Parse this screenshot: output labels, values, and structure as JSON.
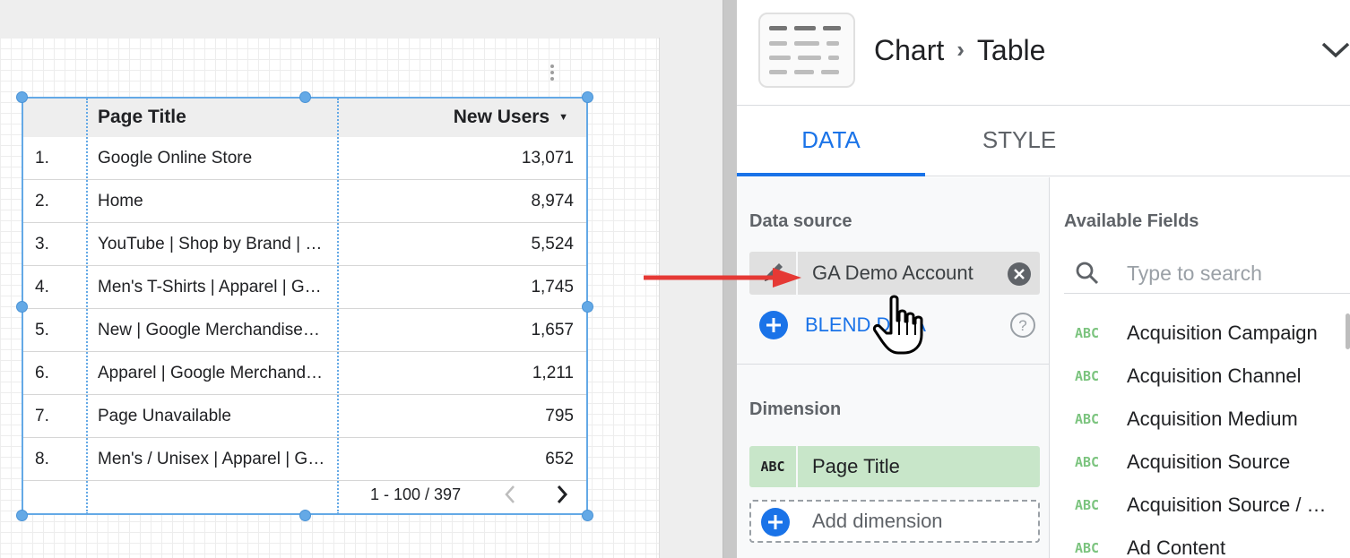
{
  "table": {
    "headers": {
      "page_title": "Page Title",
      "new_users": "New Users"
    },
    "rows": [
      {
        "index": "1.",
        "title": "Google Online Store",
        "value": "13,071"
      },
      {
        "index": "2.",
        "title": "Home",
        "value": "8,974"
      },
      {
        "index": "3.",
        "title": "YouTube | Shop by Brand | …",
        "value": "5,524"
      },
      {
        "index": "4.",
        "title": "Men's T-Shirts | Apparel | G…",
        "value": "1,745"
      },
      {
        "index": "5.",
        "title": "New | Google Merchandise…",
        "value": "1,657"
      },
      {
        "index": "6.",
        "title": "Apparel | Google Merchand…",
        "value": "1,211"
      },
      {
        "index": "7.",
        "title": "Page Unavailable",
        "value": "795"
      },
      {
        "index": "8.",
        "title": "Men's / Unisex | Apparel | G…",
        "value": "652"
      }
    ],
    "pagination": "1 - 100 / 397",
    "sort_icon": "caret-down-icon"
  },
  "panel": {
    "breadcrumb": {
      "chart": "Chart",
      "type": "Table"
    },
    "tabs": {
      "data": "DATA",
      "style": "STYLE"
    },
    "data_source": {
      "label": "Data source",
      "name": "GA Demo Account",
      "blend_label": "BLEND DATA"
    },
    "dimension": {
      "label": "Dimension",
      "type": "ABC",
      "name": "Page Title",
      "add_label": "Add dimension"
    },
    "available_fields": {
      "label": "Available Fields",
      "search_placeholder": "Type to search",
      "items": [
        {
          "type": "ABC",
          "name": "Acquisition Campaign"
        },
        {
          "type": "ABC",
          "name": "Acquisition Channel"
        },
        {
          "type": "ABC",
          "name": "Acquisition Medium"
        },
        {
          "type": "ABC",
          "name": "Acquisition Source"
        },
        {
          "type": "ABC",
          "name": "Acquisition Source / …"
        },
        {
          "type": "ABC",
          "name": "Ad Content"
        }
      ]
    }
  },
  "colors": {
    "accent_blue": "#1a73e8",
    "selection_blue": "#64a9e6",
    "dimension_green": "#c8e6c9",
    "arrow_red": "#e53935"
  }
}
